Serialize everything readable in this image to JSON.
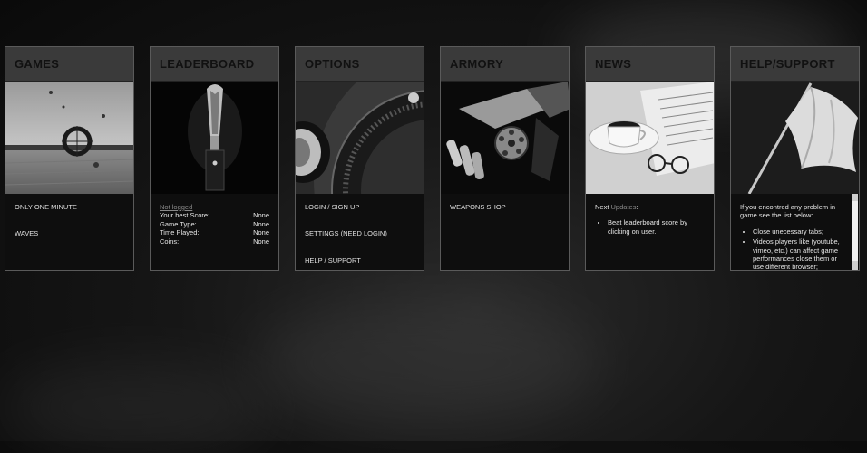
{
  "panels": {
    "games": {
      "title": "GAMES",
      "links": [
        "ONLY ONE MINUTE",
        "WAVES"
      ]
    },
    "leaderboard": {
      "title": "LEADERBOARD",
      "status": "Not logged",
      "stats": [
        {
          "label": "Your best Score:",
          "value": "None"
        },
        {
          "label": "Game Type:",
          "value": "None"
        },
        {
          "label": "Time Played:",
          "value": "None"
        },
        {
          "label": "Coins:",
          "value": "None"
        }
      ]
    },
    "options": {
      "title": "OPTIONS",
      "links": [
        "LOGIN / SIGN UP",
        "SETTINGS (NEED LOGIN)",
        "HELP / SUPPORT"
      ]
    },
    "armory": {
      "title": "ARMORY",
      "links": [
        "WEAPONS SHOP"
      ]
    },
    "news": {
      "title": "NEWS",
      "next_label": "Next",
      "updates_label": "Updates",
      "items": [
        "Beat leaderboard score by clicking on user."
      ]
    },
    "help": {
      "title": "HELP/SUPPORT",
      "intro": "If you encontred any problem in game see the list below:",
      "items": [
        "Close unecessary tabs;",
        "Videos players like (youtube, vimeo, etc.) can affect game performances close them or use different browser;"
      ]
    }
  }
}
